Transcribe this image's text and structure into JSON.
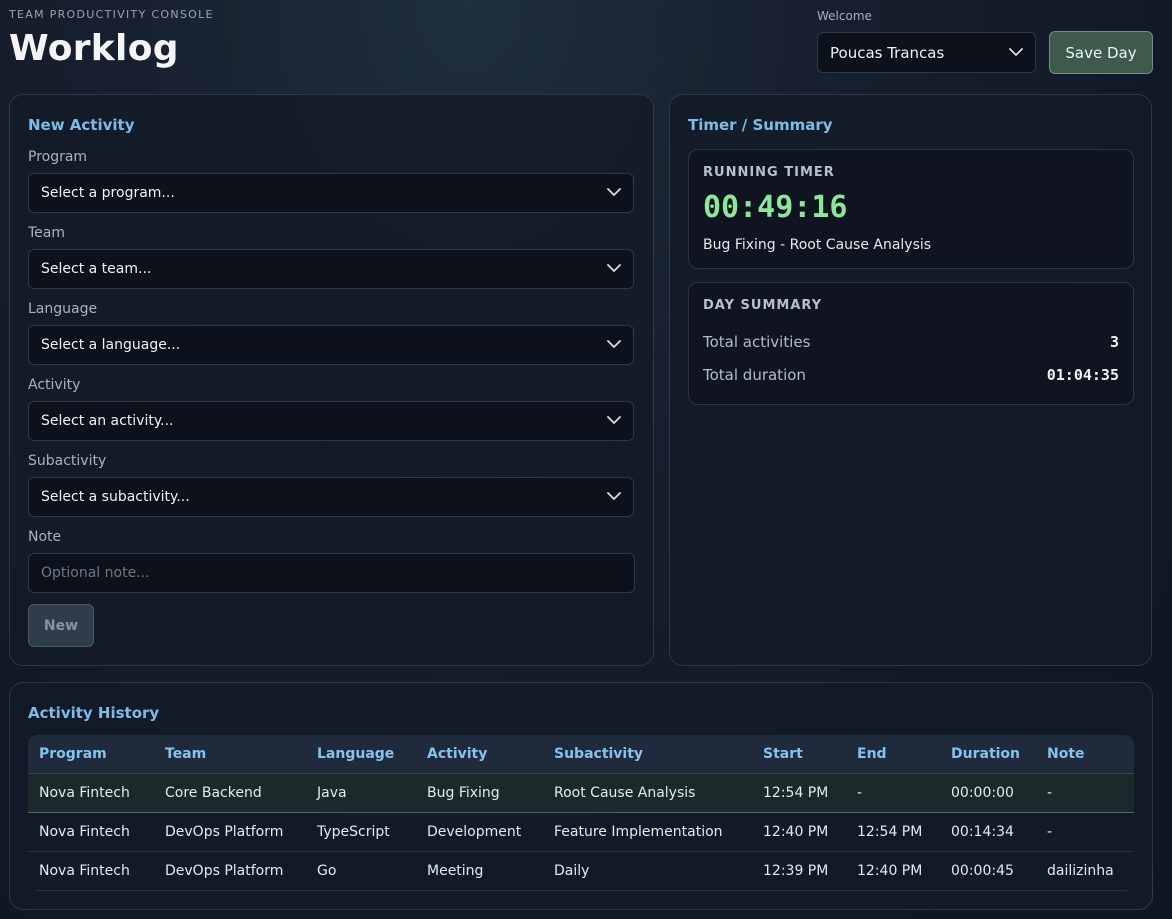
{
  "header": {
    "eyebrow": "TEAM PRODUCTIVITY CONSOLE",
    "title": "Worklog",
    "welcome_label": "Welcome",
    "user_selected": "Poucas Trancas",
    "save_label": "Save Day"
  },
  "new_activity": {
    "title": "New Activity",
    "fields": [
      {
        "label": "Program",
        "value": "Select a program..."
      },
      {
        "label": "Team",
        "value": "Select a team..."
      },
      {
        "label": "Language",
        "value": "Select a language..."
      },
      {
        "label": "Activity",
        "value": "Select an activity..."
      },
      {
        "label": "Subactivity",
        "value": "Select a subactivity..."
      }
    ],
    "note_label": "Note",
    "note_placeholder": "Optional note...",
    "note_value": "",
    "new_label": "New"
  },
  "timer_summary": {
    "title": "Timer / Summary",
    "running_timer_label": "RUNNING TIMER",
    "timer_value": "00:49:16",
    "timer_activity": "Bug Fixing - Root Cause Analysis",
    "day_summary_label": "DAY SUMMARY",
    "total_activities_label": "Total activities",
    "total_activities_value": "3",
    "total_duration_label": "Total duration",
    "total_duration_value": "01:04:35"
  },
  "history": {
    "title": "Activity History",
    "columns": [
      "Program",
      "Team",
      "Language",
      "Activity",
      "Subactivity",
      "Start",
      "End",
      "Duration",
      "Note"
    ],
    "rows": [
      [
        "Nova Fintech",
        "Core Backend",
        "Java",
        "Bug Fixing",
        "Root Cause Analysis",
        "12:54 PM",
        "-",
        "00:00:00",
        "-"
      ],
      [
        "Nova Fintech",
        "DevOps Platform",
        "TypeScript",
        "Development",
        "Feature Implementation",
        "12:40 PM",
        "12:54 PM",
        "00:14:34",
        "-"
      ],
      [
        "Nova Fintech",
        "DevOps Platform",
        "Go",
        "Meeting",
        "Daily",
        "12:39 PM",
        "12:40 PM",
        "00:00:45",
        "dailizinha"
      ]
    ]
  },
  "colors": {
    "accent_title": "#7fbbe8",
    "timer_green": "#8ee69a",
    "save_button": "#3d5a4c"
  },
  "icons": {
    "dropdown": "chevron-down-icon"
  }
}
